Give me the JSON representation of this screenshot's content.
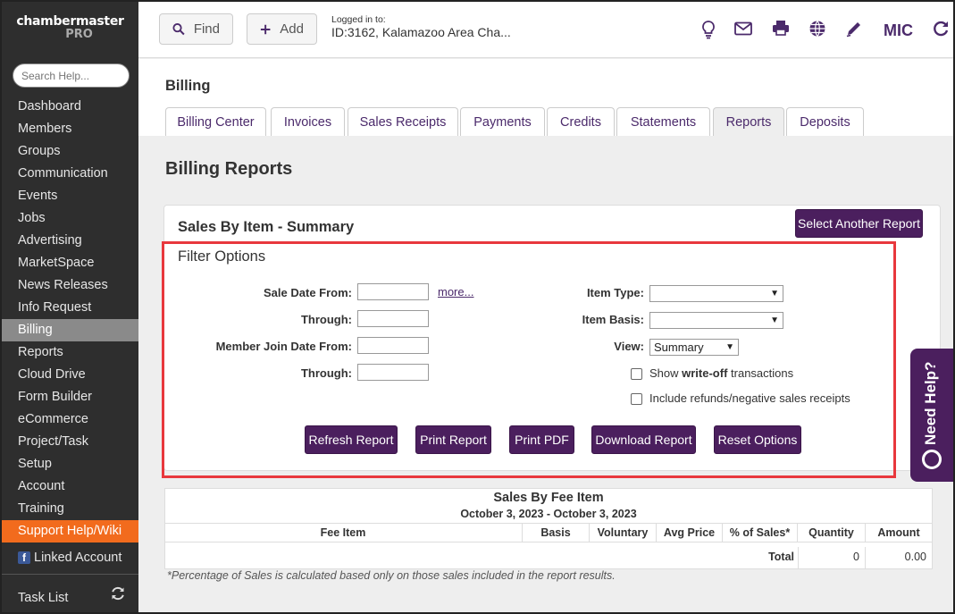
{
  "sidebar": {
    "logo_line1": "chambermaster",
    "logo_line2": "PRO",
    "search_placeholder": "Search Help...",
    "items": [
      "Dashboard",
      "Members",
      "Groups",
      "Communication",
      "Events",
      "Jobs",
      "Advertising",
      "MarketSpace",
      "News Releases",
      "Info Request",
      "Billing",
      "Reports",
      "Cloud Drive",
      "Form Builder",
      "eCommerce",
      "Project/Task",
      "Setup",
      "Account",
      "Training",
      "Support Help/Wiki"
    ],
    "active_item": "Billing",
    "linked_account": "Linked Account",
    "task_list": "Task List"
  },
  "topbar": {
    "find_label": "Find",
    "add_label": "Add",
    "login_label": "Logged in to:",
    "login_value": "ID:3162, Kalamazoo Area Cha...",
    "user_initials": "MIC"
  },
  "header": {
    "title": "Billing",
    "tabs": [
      "Billing Center",
      "Invoices",
      "Sales Receipts",
      "Payments",
      "Credits",
      "Statements",
      "Reports",
      "Deposits"
    ],
    "active_tab": "Reports"
  },
  "main": {
    "title": "Billing Reports",
    "report_title": "Sales By Item - Summary",
    "select_another_label": "Select Another Report"
  },
  "filters": {
    "title": "Filter Options",
    "sale_date_from_label": "Sale Date From:",
    "through_label": "Through:",
    "member_join_label": "Member Join Date From:",
    "through2_label": "Through:",
    "more_link": "more...",
    "item_type_label": "Item Type:",
    "item_type_value": "",
    "item_basis_label": "Item Basis:",
    "item_basis_value": "",
    "view_label": "View:",
    "view_value": "Summary",
    "writeoff_prefix": "Show ",
    "writeoff_bold": "write-off",
    "writeoff_suffix": " transactions",
    "refunds_label": "Include refunds/negative sales receipts",
    "buttons": {
      "refresh": "Refresh Report",
      "print": "Print Report",
      "pdf": "Print PDF",
      "download": "Download Report",
      "reset": "Reset Options"
    }
  },
  "table": {
    "title": "Sales By Fee Item",
    "date_range": "October 3, 2023 - October 3, 2023",
    "columns": [
      "Fee Item",
      "Basis",
      "Voluntary",
      "Avg Price",
      "% of Sales*",
      "Quantity",
      "Amount"
    ],
    "total_label": "Total",
    "total_quantity": "0",
    "total_amount": "0.00",
    "footnote": "*Percentage of Sales is calculated based only on those sales included in the report results."
  },
  "need_help": "Need Help?",
  "colors": {
    "brand_purple": "#4b1f5e",
    "support_orange": "#f26b1d",
    "highlight_red": "#e8383d"
  }
}
